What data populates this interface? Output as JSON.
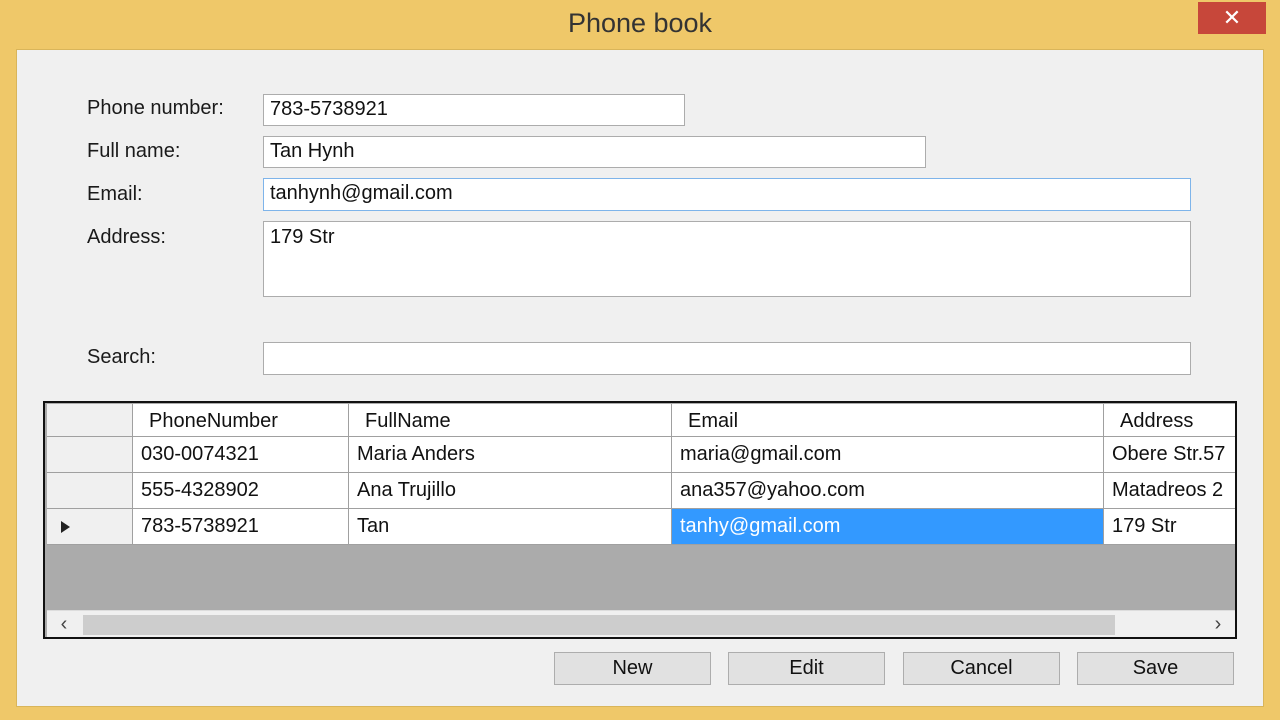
{
  "window": {
    "title": "Phone book",
    "close_icon": "close-icon"
  },
  "form": {
    "phone_label": "Phone number:",
    "phone_value": "783-5738921",
    "name_label": "Full name:",
    "name_value": "Tan Hynh",
    "email_label": "Email:",
    "email_value": "tanhynh@gmail.com",
    "address_label": "Address:",
    "address_value": "179 Str",
    "search_label": "Search:",
    "search_value": ""
  },
  "grid": {
    "columns": [
      "PhoneNumber",
      "FullName",
      "Email",
      "Address"
    ],
    "rows": [
      [
        "030-0074321",
        "Maria Anders",
        "maria@gmail.com",
        "Obere Str.57"
      ],
      [
        "555-4328902",
        "Ana Trujillo",
        "ana357@yahoo.com",
        "Matadreos 2"
      ],
      [
        "783-5738921",
        "Tan",
        "tanhy@gmail.com",
        "179 Str"
      ]
    ],
    "current_row_icon": "current-row-arrow-icon",
    "scroll_left_icon": "scroll-left-icon",
    "scroll_right_icon": "scroll-right-icon"
  },
  "buttons": {
    "new": "New",
    "edit": "Edit",
    "cancel": "Cancel",
    "save": "Save"
  },
  "colors": {
    "window_frame": "#efc869",
    "close_button": "#c7473a",
    "selection": "#3399ff"
  }
}
